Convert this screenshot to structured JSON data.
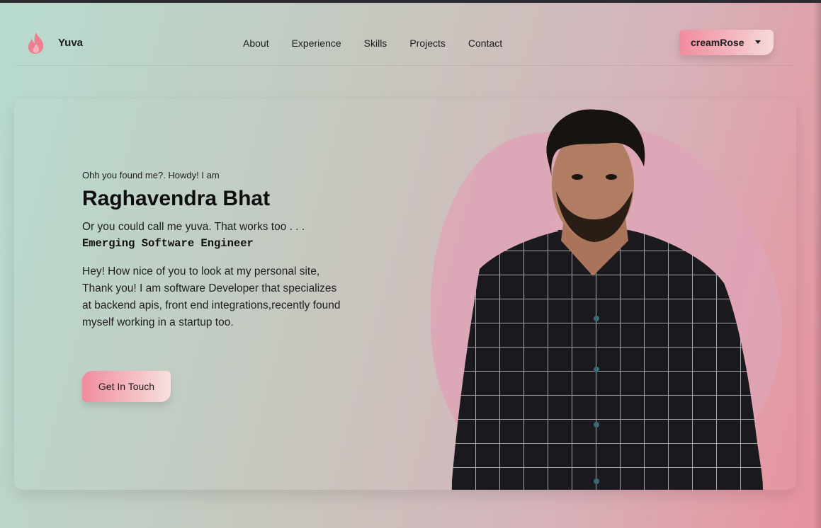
{
  "header": {
    "brand": "Yuva",
    "logo_icon": "flame-icon",
    "nav": [
      "About",
      "Experience",
      "Skills",
      "Projects",
      "Contact"
    ],
    "theme_select": {
      "value": "creamRose",
      "icon": "caret-down-icon"
    }
  },
  "hero": {
    "intro": "Ohh you found me?. Howdy! I am",
    "name": "Raghavendra Bhat",
    "alias": "Or you could call me yuva. That works too . . .",
    "role": "Emerging Software Engineer",
    "bio": "Hey! How nice of you to look at my personal site, Thank you! I am software Developer that specializes at backend apis, front end integrations,recently found myself working in a startup too.",
    "cta_label": "Get In Touch"
  },
  "colors": {
    "accent": "#f08c9e",
    "accent_light": "#f8e0de",
    "blob": "#dea5b6",
    "text": "#1d1d1f"
  }
}
